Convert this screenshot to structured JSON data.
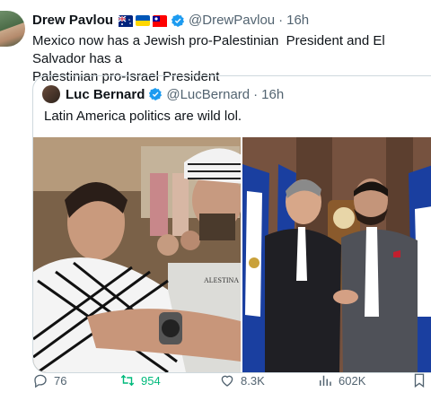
{
  "tweet": {
    "author_name": "Drew Pavlou",
    "author_flags": [
      "australia-flag",
      "ukraine-flag",
      "taiwan-flag"
    ],
    "handle": "@DrewPavlou",
    "separator": "·",
    "time": "16h",
    "text": "Mexico now has a Jewish pro-Palestinian  President and El Salvador has a\nPalestinian pro-Israel President"
  },
  "quote": {
    "author_name": "Luc Bernard",
    "handle": "@LucBernard",
    "separator": "·",
    "time": "16h",
    "text": "Latin America politics are wild lol.",
    "photo_left_caption": "ALESTINA",
    "photos": [
      "woman-in-keffiyeh-embrace-photo",
      "handshake-in-front-of-flags-photo"
    ]
  },
  "actions": {
    "replies": "76",
    "retweets": "954",
    "likes": "",
    "views": "602K",
    "view_count_likes": "8.3K"
  },
  "colors": {
    "verified": "#1d9bf0",
    "retweet_active": "#00ba7c",
    "muted": "#536471",
    "border": "#cfd9de"
  }
}
